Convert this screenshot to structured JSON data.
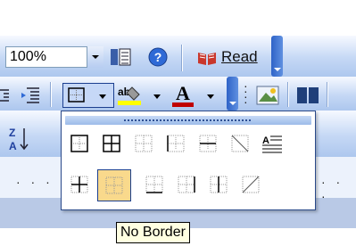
{
  "toolbar": {
    "zoom_value": "100%",
    "read_label": "Read"
  },
  "border_menu": {
    "tooltip": "No Border",
    "items": [
      "outside-border-icon",
      "all-borders-icon",
      "inside-borders-icon",
      "left-border-icon",
      "top-bottom-borders-icon",
      "diagonal-down-border-icon",
      "horizontal-line-icon",
      "inside-cross-border-icon",
      "no-border-icon",
      "bottom-border-icon",
      "right-border-icon",
      "inside-vertical-border-icon",
      "diagonal-up-border-icon"
    ]
  },
  "colors": {
    "accent": "#2e63c8",
    "highlight": "#f9d98c",
    "tooltip_bg": "#ffffe1"
  }
}
